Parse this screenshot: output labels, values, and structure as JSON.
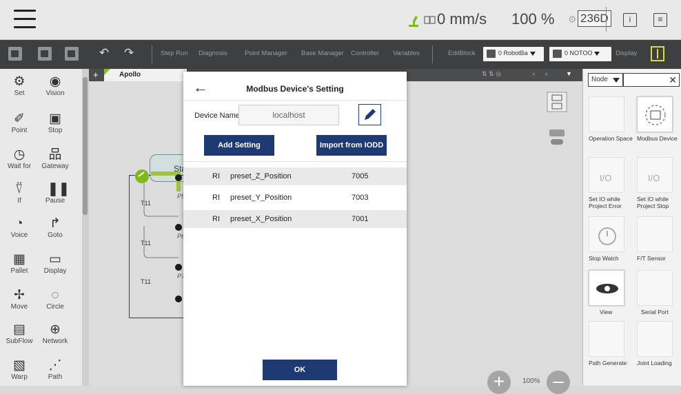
{
  "topbar": {
    "speed": "0 mm/s",
    "percent": "100 %",
    "badge": "236D"
  },
  "toolbar": {
    "step_run": "Step Run",
    "diagnosis": "Diagnosis",
    "point_manager": "Point Manager",
    "base_manager": "Base Manager",
    "controller": "Controller",
    "variables": "Variables",
    "edit_block": "EditBlock",
    "robot_base_select": "0 RobotBa",
    "tool_select": "0 NOTOO",
    "display": "Display"
  },
  "left_palette": [
    {
      "label": "Set",
      "icon": "set-icon"
    },
    {
      "label": "Vision",
      "icon": "vision-icon"
    },
    {
      "label": "Point",
      "icon": "point-icon"
    },
    {
      "label": "Stop",
      "icon": "stop-icon"
    },
    {
      "label": "Wait for",
      "icon": "wait-for-icon"
    },
    {
      "label": "Gateway",
      "icon": "gateway-icon"
    },
    {
      "label": "If",
      "icon": "if-icon"
    },
    {
      "label": "Pause",
      "icon": "pause-icon"
    },
    {
      "label": "Voice",
      "icon": "voice-icon"
    },
    {
      "label": "Goto",
      "icon": "goto-icon"
    },
    {
      "label": "Pallet",
      "icon": "pallet-icon"
    },
    {
      "label": "Display",
      "icon": "display-icon"
    },
    {
      "label": "Move",
      "icon": "move-icon"
    },
    {
      "label": "Circle",
      "icon": "circle-icon"
    },
    {
      "label": "SubFlow",
      "icon": "subflow-icon"
    },
    {
      "label": "Network",
      "icon": "network-icon"
    },
    {
      "label": "Warp",
      "icon": "warp-icon"
    },
    {
      "label": "Path",
      "icon": "path-icon"
    }
  ],
  "canvas": {
    "tab_name": "Apollo",
    "start_label": "Sta",
    "t11": "T11",
    "p5": "P5",
    "p6": "P6",
    "p7": "P7",
    "zoom": "100%"
  },
  "right_panel": {
    "filter": "Node",
    "items": [
      {
        "label": "Operation Space",
        "icon": "operation-space-icon"
      },
      {
        "label": "Modbus Device",
        "icon": "modbus-device-icon"
      },
      {
        "label": "Set IO while Project Error",
        "icon": "io-error-icon"
      },
      {
        "label": "Set IO while Project Stop",
        "icon": "io-stop-icon"
      },
      {
        "label": "Stop Watch",
        "icon": "stopwatch-icon"
      },
      {
        "label": "F/T Sensor",
        "icon": "ft-sensor-icon"
      },
      {
        "label": "View",
        "icon": "view-icon"
      },
      {
        "label": "Serial Port",
        "icon": "serial-port-icon"
      },
      {
        "label": "Path Generate",
        "icon": "path-generate-icon"
      },
      {
        "label": "Joint Loading",
        "icon": "joint-loading-icon"
      }
    ]
  },
  "modal": {
    "title": "Modbus Device's Setting",
    "device_name_label": "Device Name",
    "device_name_value": "localhost",
    "add_setting": "Add Setting",
    "import_iodd": "Import from IODD",
    "rows": [
      {
        "type": "RI",
        "name": "preset_Z_Position",
        "address": "7005"
      },
      {
        "type": "RI",
        "name": "preset_Y_Position",
        "address": "7003"
      },
      {
        "type": "RI",
        "name": "preset_X_Position",
        "address": "7001"
      }
    ],
    "ok": "OK"
  }
}
